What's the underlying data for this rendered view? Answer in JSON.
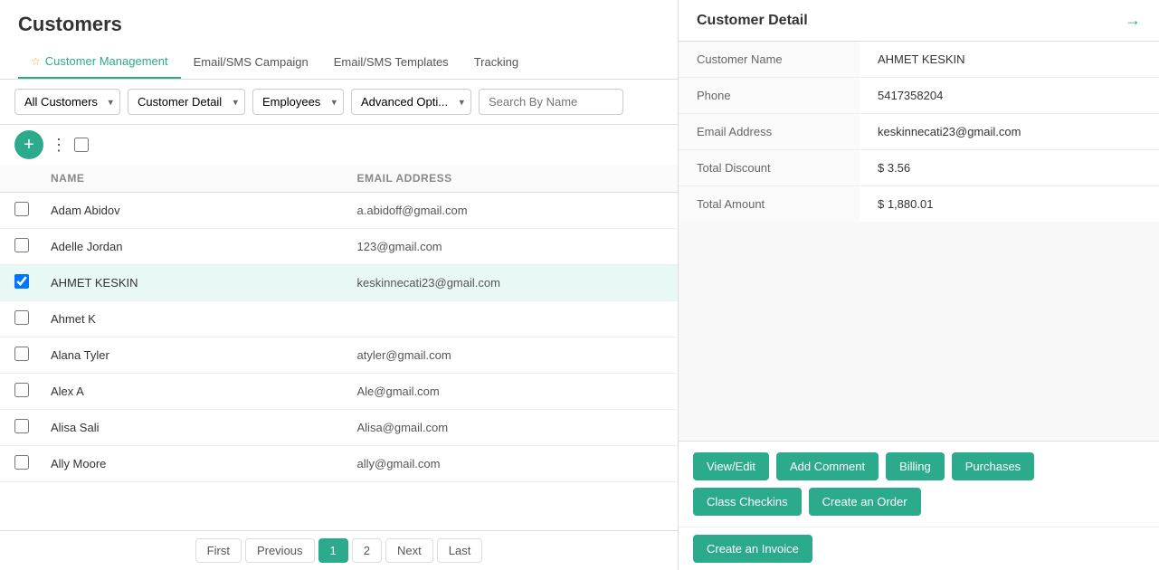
{
  "page": {
    "title": "Customers",
    "detail_title": "Customer Detail"
  },
  "nav": {
    "tabs": [
      {
        "label": "Customer Management",
        "active": true,
        "has_star": true
      },
      {
        "label": "Email/SMS Campaign",
        "active": false,
        "has_star": false
      },
      {
        "label": "Email/SMS Templates",
        "active": false,
        "has_star": false
      },
      {
        "label": "Tracking",
        "active": false,
        "has_star": false
      }
    ]
  },
  "toolbar": {
    "filter_all": "All Customers",
    "filter_detail": "Customer Detail",
    "filter_employees": "Employees",
    "filter_advanced": "Advanced Opti...",
    "search_placeholder": "Search By Name"
  },
  "table": {
    "col_name": "NAME",
    "col_email": "EMAIL ADDRESS",
    "rows": [
      {
        "name": "Adam Abidov",
        "email": "a.abidoff@gmail.com",
        "selected": false
      },
      {
        "name": "Adelle Jordan",
        "email": "123@gmail.com",
        "selected": false
      },
      {
        "name": "AHMET KESKIN",
        "email": "keskinnecati23@gmail.com",
        "selected": true
      },
      {
        "name": "Ahmet K",
        "email": "",
        "selected": false
      },
      {
        "name": "Alana Tyler",
        "email": "atyler@gmail.com",
        "selected": false
      },
      {
        "name": "Alex A",
        "email": "Ale@gmail.com",
        "selected": false
      },
      {
        "name": "Alisa Sali",
        "email": "Alisa@gmail.com",
        "selected": false
      },
      {
        "name": "Ally Moore",
        "email": "ally@gmail.com",
        "selected": false
      }
    ]
  },
  "pagination": {
    "first": "First",
    "previous": "Previous",
    "next": "Next",
    "last": "Last",
    "pages": [
      1,
      2
    ],
    "active_page": 1
  },
  "detail": {
    "fields": [
      {
        "label": "Customer Name",
        "value": "AHMET KESKIN"
      },
      {
        "label": "Phone",
        "value": "5417358204"
      },
      {
        "label": "Email Address",
        "value": "keskinnecati23@gmail.com"
      },
      {
        "label": "Total Discount",
        "value": "$ 3.56"
      },
      {
        "label": "Total Amount",
        "value": "$ 1,880.01"
      }
    ],
    "actions": [
      {
        "label": "View/Edit"
      },
      {
        "label": "Add Comment"
      },
      {
        "label": "Billing"
      },
      {
        "label": "Purchases"
      },
      {
        "label": "Class Checkins"
      },
      {
        "label": "Create an Order"
      }
    ],
    "invoice_label": "Create an Invoice",
    "arrow_icon": "→"
  },
  "colors": {
    "primary": "#2baa8c",
    "accent_star": "#f5a623"
  }
}
